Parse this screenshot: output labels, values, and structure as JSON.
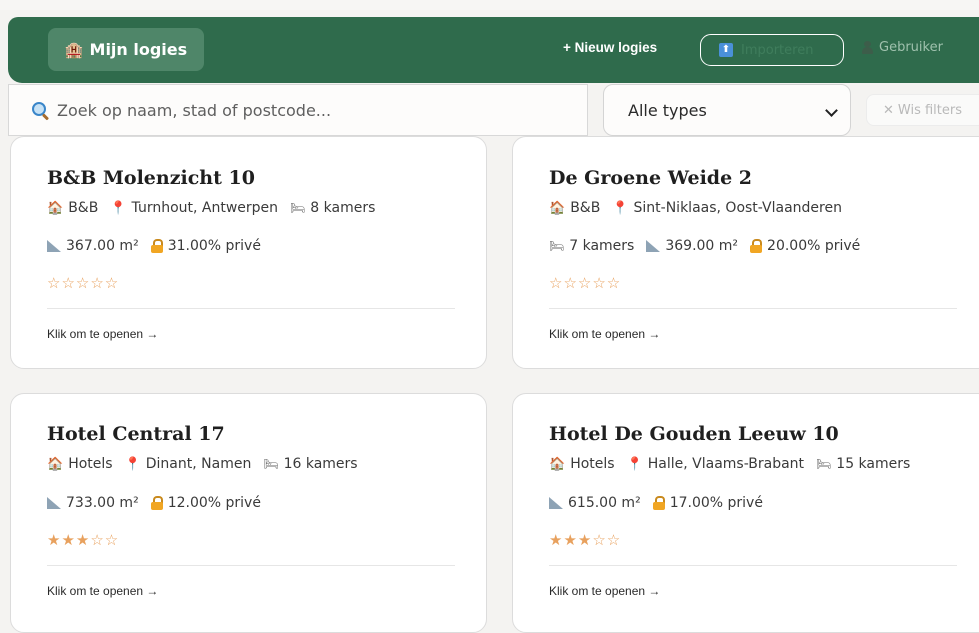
{
  "header": {
    "brand_icon": "🏨",
    "brand_label": "Mijn logies",
    "new_label": "+ Nieuw logies",
    "import_icon": "⬆",
    "import_label": "Importeren",
    "user_label": "Gebruiker"
  },
  "search": {
    "placeholder": "Zoek op naam, stad of postcode..."
  },
  "filter": {
    "type_selected": "Alle types",
    "clear_label": "Wis filters",
    "clear_icon": "✕"
  },
  "icons": {
    "house": "🏠",
    "pin": "📍",
    "bed": "🛏"
  },
  "cards": [
    {
      "title": "B&B Molenzicht 10",
      "type": "B&B",
      "location": "Turnhout, Antwerpen",
      "rooms": "8 kamers",
      "area": "367.00 m²",
      "private": "31.00% privé",
      "stars": "☆☆☆☆☆",
      "rating": 0,
      "open_label": "Klik om te openen →"
    },
    {
      "title": "De Groene Weide 2",
      "type": "B&B",
      "location": "Sint-Niklaas, Oost-Vlaanderen",
      "rooms": "7 kamers",
      "area": "369.00 m²",
      "private": "20.00% privé",
      "stars": "☆☆☆☆☆",
      "rating": 0,
      "open_label": "Klik om te openen →"
    },
    {
      "title": "Hotel Central 17",
      "type": "Hotels",
      "location": "Dinant, Namen",
      "rooms": "16 kamers",
      "area": "733.00 m²",
      "private": "12.00% privé",
      "stars": "★★★☆☆",
      "rating": 3,
      "open_label": "Klik om te openen →"
    },
    {
      "title": "Hotel De Gouden Leeuw 10",
      "type": "Hotels",
      "location": "Halle, Vlaams-Brabant",
      "rooms": "15 kamers",
      "area": "615.00 m²",
      "private": "17.00% privé",
      "stars": "★★★☆☆",
      "rating": 3,
      "open_label": "Klik om te openen →"
    }
  ],
  "colors": {
    "header_bg": "#2f6b4c",
    "brand_button_bg": "#4f8669",
    "star": "#e8a15e"
  }
}
